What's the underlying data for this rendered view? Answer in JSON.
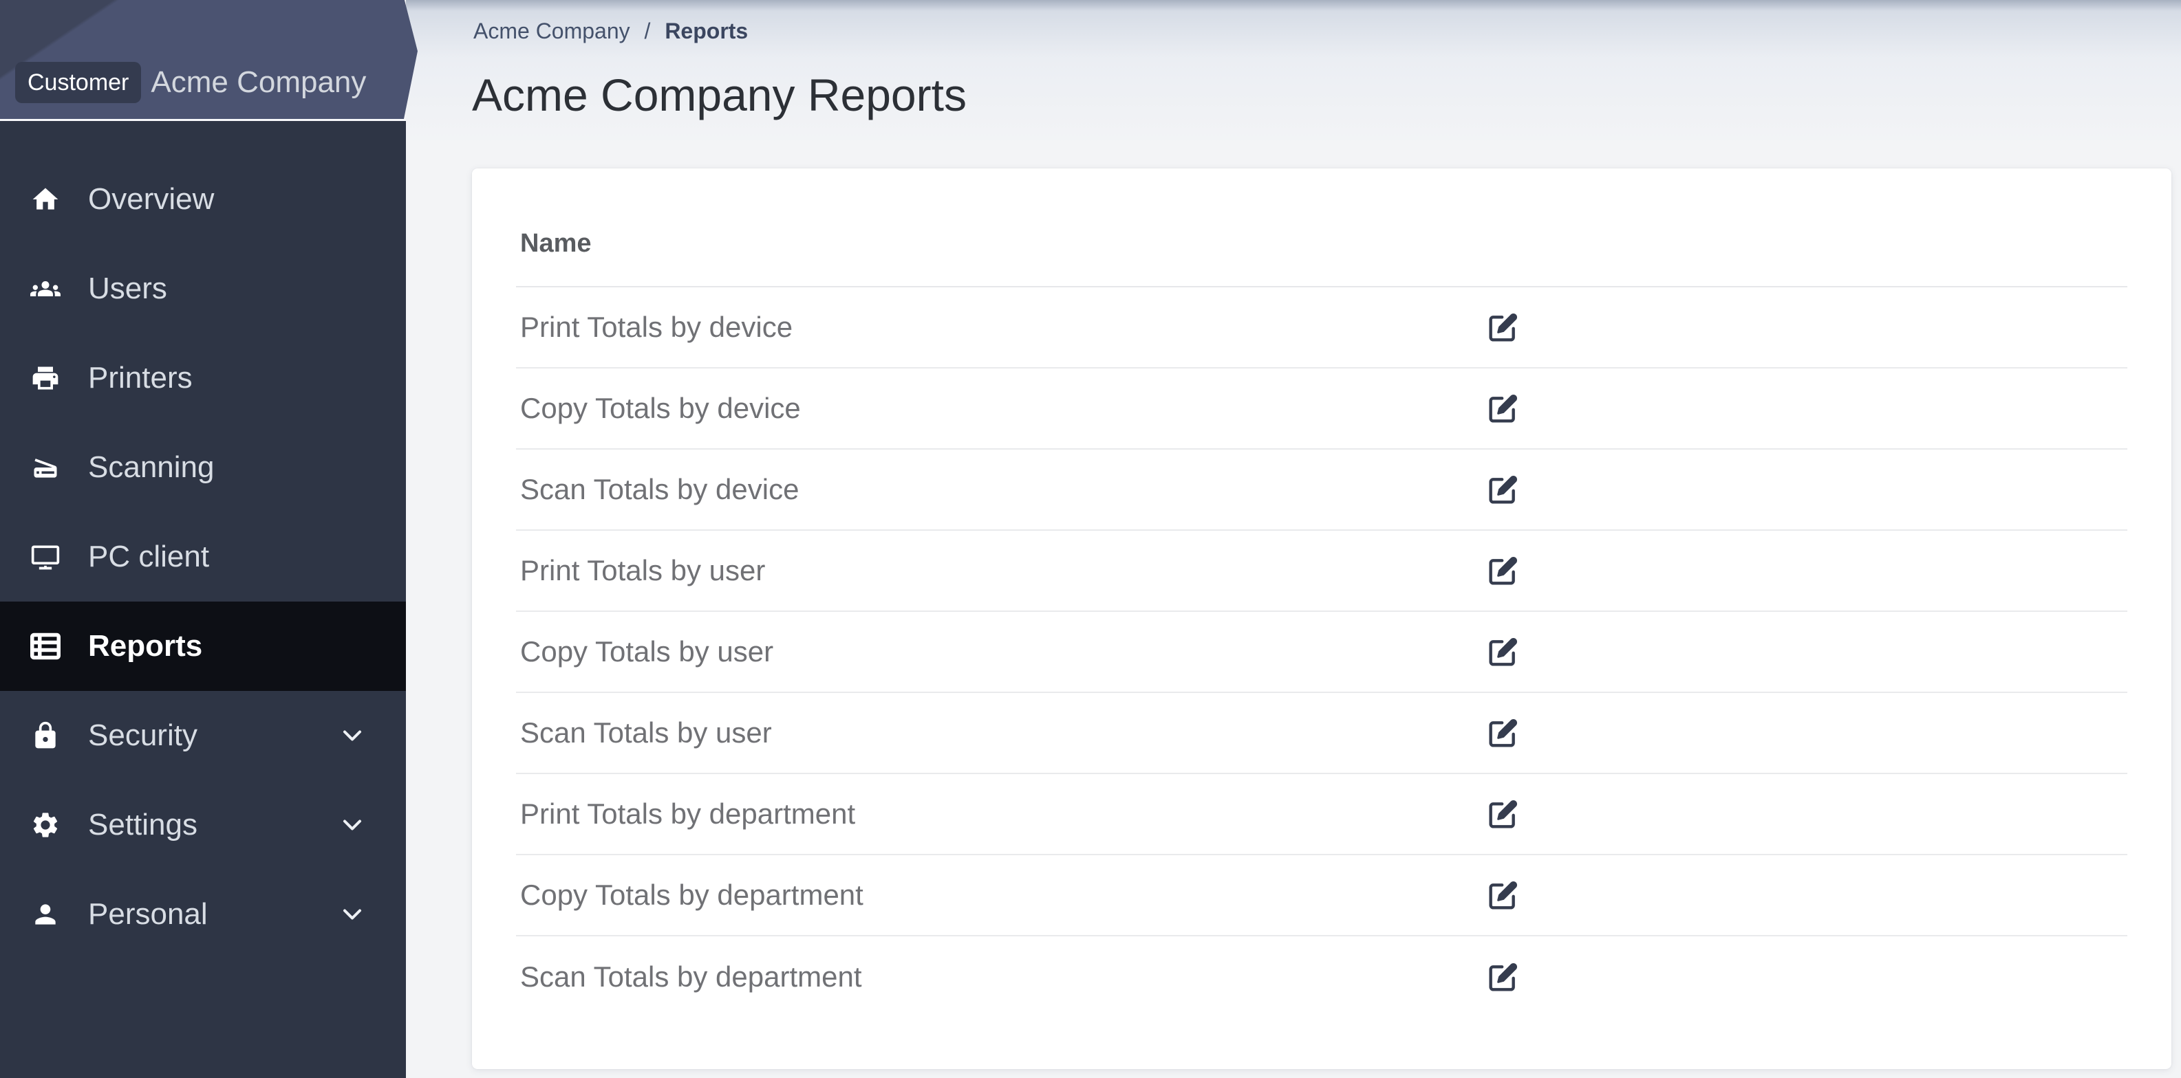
{
  "banner": {
    "badge_label": "Customer",
    "company_name": "Acme Company"
  },
  "breadcrumb": {
    "parent": "Acme Company",
    "separator": "/",
    "current": "Reports"
  },
  "page": {
    "title": "Acme Company Reports"
  },
  "sidebar": {
    "items": [
      {
        "label": "Overview",
        "icon": "home",
        "selected": false,
        "expandable": false
      },
      {
        "label": "Users",
        "icon": "users-group",
        "selected": false,
        "expandable": false
      },
      {
        "label": "Printers",
        "icon": "printer",
        "selected": false,
        "expandable": false
      },
      {
        "label": "Scanning",
        "icon": "scanner",
        "selected": false,
        "expandable": false
      },
      {
        "label": "PC client",
        "icon": "desktop",
        "selected": false,
        "expandable": false
      },
      {
        "label": "Reports",
        "icon": "report-list",
        "selected": true,
        "expandable": false
      },
      {
        "label": "Security",
        "icon": "lock",
        "selected": false,
        "expandable": true
      },
      {
        "label": "Settings",
        "icon": "gear",
        "selected": false,
        "expandable": true
      },
      {
        "label": "Personal",
        "icon": "person",
        "selected": false,
        "expandable": true
      }
    ],
    "chevron_icon": "chevron-down"
  },
  "table": {
    "name_header": "Name",
    "row_action_icon": "edit-pen-square",
    "rows": [
      "Print Totals by device",
      "Copy Totals by device",
      "Scan Totals by device",
      "Print Totals by user",
      "Copy Totals by user",
      "Scan Totals by user",
      "Print Totals by department",
      "Copy Totals by department",
      "Scan Totals by department"
    ]
  },
  "colors": {
    "sidebar_bg": "#2e3545",
    "sidebar_selected_bg": "#0d0f15",
    "banner_bg": "#4b5371",
    "banner_badge_bg": "#343b4f",
    "content_bg": "#f3f4f6",
    "card_bg": "#ffffff",
    "row_text": "#707175",
    "action_icon": "#353c4e"
  }
}
